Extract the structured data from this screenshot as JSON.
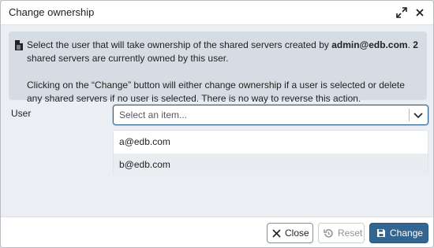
{
  "dialog": {
    "title": "Change ownership",
    "maximize_icon": "expand-diagonal-icon",
    "close_icon": "close-icon"
  },
  "info": {
    "icon": "document-icon",
    "line1_prefix": "Select the user that will take ownership of the shared servers created by ",
    "line1_owner": "admin@edb.com",
    "line1_middle": ". ",
    "line1_count": "2",
    "line1_suffix": " shared servers are currently owned by this user.",
    "line2": "Clicking on the “Change” button will either change ownership if a user is selected or delete any shared servers if no user is selected. There is no way to reverse this action."
  },
  "form": {
    "user_label": "User",
    "select_placeholder": "Select an item...",
    "options": [
      "a@edb.com",
      "b@edb.com"
    ]
  },
  "footer": {
    "close_label": "Close",
    "reset_label": "Reset",
    "change_label": "Change"
  },
  "colors": {
    "accent": "#326690",
    "info_bg": "#d6dce4",
    "body_bg": "#ebeef3"
  }
}
